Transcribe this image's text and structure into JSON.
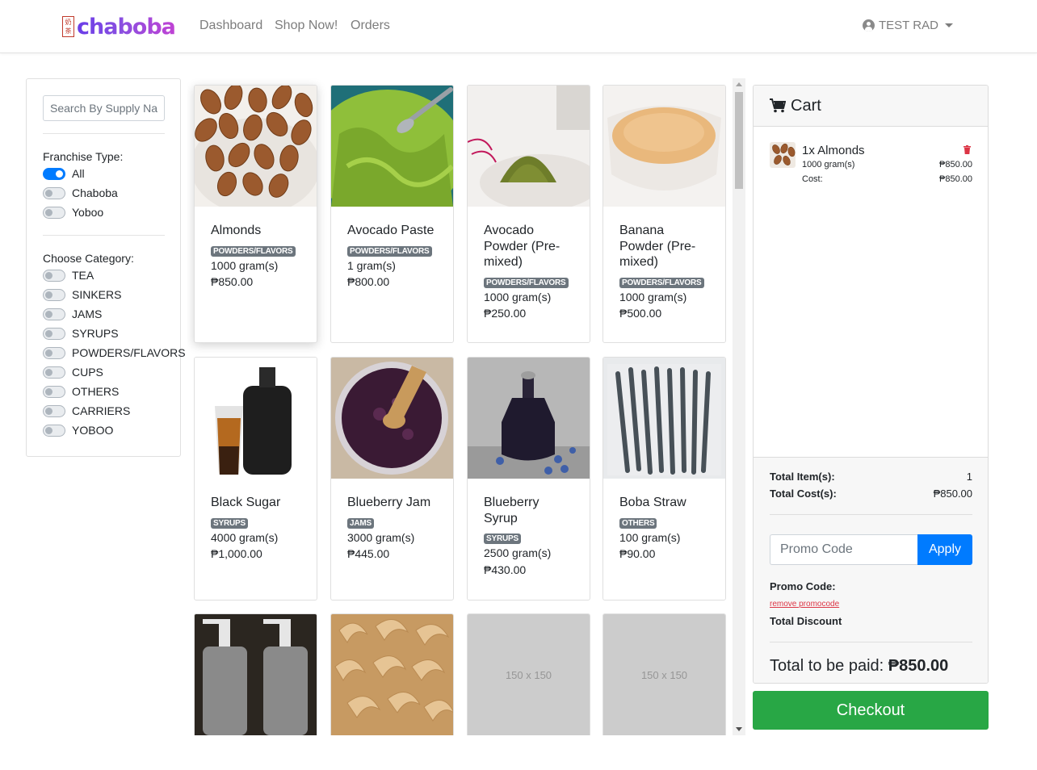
{
  "brand": {
    "name": "chaboba",
    "seal": "奶茶"
  },
  "nav": {
    "items": [
      "Dashboard",
      "Shop Now!",
      "Orders"
    ],
    "user": "TEST RAD"
  },
  "filters": {
    "search_placeholder": "Search By Supply Name",
    "franchise_label": "Franchise Type:",
    "franchise_options": [
      {
        "label": "All",
        "checked": true
      },
      {
        "label": "Chaboba",
        "checked": false
      },
      {
        "label": "Yoboo",
        "checked": false
      }
    ],
    "category_label": "Choose Category:",
    "categories": [
      "TEA",
      "SINKERS",
      "JAMS",
      "SYRUPS",
      "POWDERS/FLAVORS",
      "CUPS",
      "OTHERS",
      "CARRIERS",
      "YOBOO"
    ]
  },
  "products": [
    {
      "name": "Almonds",
      "category": "POWDERS/FLAVORS",
      "qty": "1000 gram(s)",
      "price": "₱850.00",
      "image": "almonds"
    },
    {
      "name": "Avocado Paste",
      "category": "POWDERS/FLAVORS",
      "qty": "1 gram(s)",
      "price": "₱800.00",
      "image": "avocado-paste"
    },
    {
      "name": "Avocado Powder (Pre-mixed)",
      "category": "POWDERS/FLAVORS",
      "qty": "1000 gram(s)",
      "price": "₱250.00",
      "image": "matcha-powder"
    },
    {
      "name": "Banana Powder (Pre-mixed)",
      "category": "POWDERS/FLAVORS",
      "qty": "1000 gram(s)",
      "price": "₱500.00",
      "image": "banana-powder"
    },
    {
      "name": "Black Sugar",
      "category": "SYRUPS",
      "qty": "4000 gram(s)",
      "price": "₱1,000.00",
      "image": "black-sugar"
    },
    {
      "name": "Blueberry Jam",
      "category": "JAMS",
      "qty": "3000 gram(s)",
      "price": "₱445.00",
      "image": "blueberry-jam"
    },
    {
      "name": "Blueberry Syrup",
      "category": "SYRUPS",
      "qty": "2500 gram(s)",
      "price": "₱430.00",
      "image": "blueberry-syrup"
    },
    {
      "name": "Boba Straw",
      "category": "OTHERS",
      "qty": "100 gram(s)",
      "price": "₱90.00",
      "image": "boba-straw"
    },
    {
      "name": "",
      "category": "",
      "qty": "",
      "price": "",
      "image": "pump-bottles"
    },
    {
      "name": "",
      "category": "",
      "qty": "",
      "price": "",
      "image": "cashews"
    },
    {
      "name": "",
      "category": "",
      "qty": "",
      "price": "",
      "image": "placeholder",
      "placeholder_text": "150 x 150"
    },
    {
      "name": "",
      "category": "",
      "qty": "",
      "price": "",
      "image": "placeholder",
      "placeholder_text": "150 x 150"
    }
  ],
  "cart": {
    "title": "Cart",
    "items": [
      {
        "qty_name": "1x Almonds",
        "amount": "1000 gram(s)",
        "price": "₱850.00",
        "cost_label": "Cost:",
        "cost": "₱850.00"
      }
    ],
    "total_items_label": "Total Item(s):",
    "total_items": "1",
    "total_cost_label": "Total Cost(s):",
    "total_cost": "₱850.00",
    "promo_placeholder": "Promo Code",
    "apply_label": "Apply",
    "promo_code_label": "Promo Code:",
    "remove_promo_label": "remove promocode",
    "total_discount_label": "Total Discount",
    "total_paid_label": "Total to be paid:",
    "total_paid": "₱850.00",
    "checkout_label": "Checkout"
  },
  "colors": {
    "primary": "#007bff",
    "success": "#28a745",
    "danger": "#dc3545",
    "badge": "#6c757d"
  }
}
